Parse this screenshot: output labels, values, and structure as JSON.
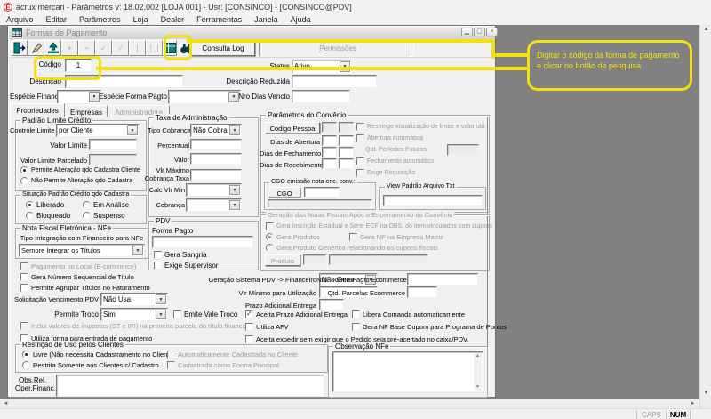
{
  "window": {
    "title": "acrux mercari - Parâmetros  v: 18.02.002   [LOJA 001] - Usr: [CONSINCO] - [CONSINCO@PDV]",
    "app_initial": "E",
    "menu": [
      "Arquivo",
      "Editar",
      "Parâmetros",
      "Loja",
      "Dealer",
      "Ferramentas",
      "Janela",
      "Ajuda"
    ]
  },
  "statusbar": {
    "caps": "CAPS",
    "num": "NUM"
  },
  "annotation": {
    "text": "Digitar o código da forma de pagamento e clicar no botão de pesquisa",
    "color": "#f2e10e"
  },
  "child": {
    "title": "Formas de Pagamento",
    "toolbar": {
      "consulta_log": "Consulta Log",
      "permissoes": "Permissões"
    },
    "header": {
      "codigo_label": "Código",
      "codigo_value": "1",
      "status_label": "Status",
      "status_value": "Ativo",
      "descricao_label": "Descrição",
      "descricao_value": "",
      "descricao_reduzida_label": "Descrição Reduzida",
      "descricao_reduzida_value": "",
      "especie_financeira_label": "Espécie Financeira",
      "especie_forma_pagto_label": "Espécie Forma Pagto",
      "nro_dias_vencto_label": "Nro Dias Vencto"
    },
    "tabs": [
      {
        "label": "Propriedades"
      },
      {
        "label": "Empresas"
      },
      {
        "label": "Administradora"
      }
    ],
    "plc": {
      "title": "Padrão Limite Crédito",
      "controle_limite_label": "Controle Limite",
      "controle_limite_value": "por Cliente",
      "valor_limite_label": "Valor Limite",
      "valor_limite_parcelado_label": "Valor Limite Parcelado",
      "r1": "Permite Alteração qdo Cadastra Cliente",
      "r2": "Não Permite Alteração qdo Cadastra"
    },
    "spc": {
      "title": "Situação Padrão Crédito qdo Cadastra",
      "r1": "Liberado",
      "r2": "Em Análise",
      "r3": "Bloqueado",
      "r4": "Suspenso"
    },
    "nfe": {
      "title": "Nota Fiscal Eletrônica - NFe",
      "tipo_label": "Tipo Integração com Financeiro para NFe",
      "tipo_value": "Sempre Integrar os Títulos"
    },
    "checks": {
      "pagamento_local": "Pagamento no Local (E-commerce)",
      "gera_numero": "Gera Número Sequencial de Título",
      "permite_agrupar": "Permite Agrupar Títulos no Faturamento",
      "emite_vale": "Emite Vale Troco",
      "inclui_impostos": "Inclui valores de impostos (ST e IPI) na primeira parcela do título financeiro",
      "utiliza_forma": "Utiliza forma para entrada de pagamento",
      "aceita_prazo": "Aceita Prazo Adicional Entrega",
      "libera_comanda": "Libera Comanda automaticamente",
      "utiliza_afv": "Utiliza AFV",
      "gera_nf_base": "Gera NF Base Cupom para Programa de Pontos",
      "aceita_expedir": "Aceita expedir sem exigir que o Pedido seja pré-acertado no caixa/PDV."
    },
    "solicitacao": {
      "label": "Solicitação Vencimento PDV",
      "value": "Não Usa"
    },
    "permite_troco": {
      "label": "Permite Troco",
      "value": "Sim"
    },
    "restricao": {
      "title": "Restrição de Uso pelos Clientes",
      "r1": "Livre (Não necessita Cadastramento no Cliente)",
      "r2": "Restrita Somente aos Clientes c/ Cadastro",
      "c1": "Automaticamente Cadastrada no Cliente",
      "c2": "Cadastrada como Forma Principal"
    },
    "obs": {
      "l1": "Obs.Rel.",
      "l2": "Oper.Financ."
    },
    "taxa": {
      "title": "Taxa de Administração",
      "tipo_cobranca_label": "Tipo Cobrança",
      "tipo_cobranca_value": "Não Cobra",
      "percentual_label": "Percentual",
      "valor_label": "Valor",
      "vlr_maximo_l1": "Vlr Máximo",
      "vlr_maximo_l2": "Cobrança Taxa",
      "calc_vlr_min_label": "Calc Vlr Min",
      "cobranca_label": "Cobrança"
    },
    "pdv": {
      "title": "PDV",
      "forma_pagto_label": "Forma Pagto",
      "gera_sangria": "Gera Sangria",
      "exige_supervisor": "Exige Supervisor"
    },
    "convenio": {
      "title": "Parâmetros do Convênio",
      "codigo_pessoa": "Codigo Pessoa",
      "dias_abertura": "Dias de Abertura",
      "dias_fechamento": "Dias de Fechamento",
      "dias_recebimento": "Dias de Recebimento",
      "restringe": "Restringe visualização de limite e valor util.",
      "abertura_auto": "Abertura automática",
      "qtd_periodos": "Qtd. Períodos Futuros",
      "fechamento_auto": "Fechamento automático",
      "exige_req": "Exige Requisição",
      "cgo_group": "CGO emissão nota enc. conv.:",
      "cgo": "CGO",
      "view_txt": "View Padrão Arquivo Txt"
    },
    "geracao_nf": {
      "title": "Geração das Notas Fiscais Após o Encerramento do Convênio",
      "c1": "Gera Inscrição Estadual e Série ECF na OBS. do item vinculados com cupons",
      "r1": "Gera Produtos",
      "c2": "Gera NF na Empresa Matriz",
      "r2": "Gera Produto Genérico relacionando os cupons fiscais",
      "produto": "Produto"
    },
    "rows": {
      "geracao_pdv_label": "Geração Sistema PDV -> Financeiro",
      "geracao_pdv_value": "Não Gerar",
      "nro_forma_label": "Nro. Forma Pagto Ecommerce",
      "vlr_minimo_label": "Vlr Mínimo para Utilização",
      "qtd_parcelas_label": "Qtd. Parcelas Ecommerce",
      "prazo_adicional_label": "Prazo Adicional Entrega"
    },
    "obs_nfe": {
      "title": "Observação NFe"
    }
  }
}
